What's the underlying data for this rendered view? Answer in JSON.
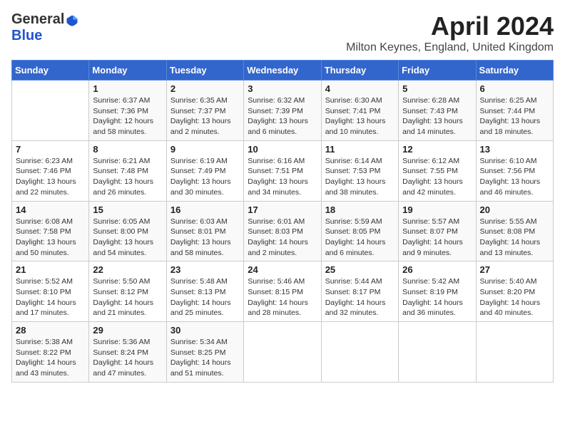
{
  "header": {
    "logo_general": "General",
    "logo_blue": "Blue",
    "month_title": "April 2024",
    "location": "Milton Keynes, England, United Kingdom"
  },
  "days_of_week": [
    "Sunday",
    "Monday",
    "Tuesday",
    "Wednesday",
    "Thursday",
    "Friday",
    "Saturday"
  ],
  "weeks": [
    [
      {
        "day": "",
        "sunrise": "",
        "sunset": "",
        "daylight": ""
      },
      {
        "day": "1",
        "sunrise": "Sunrise: 6:37 AM",
        "sunset": "Sunset: 7:36 PM",
        "daylight": "Daylight: 12 hours and 58 minutes."
      },
      {
        "day": "2",
        "sunrise": "Sunrise: 6:35 AM",
        "sunset": "Sunset: 7:37 PM",
        "daylight": "Daylight: 13 hours and 2 minutes."
      },
      {
        "day": "3",
        "sunrise": "Sunrise: 6:32 AM",
        "sunset": "Sunset: 7:39 PM",
        "daylight": "Daylight: 13 hours and 6 minutes."
      },
      {
        "day": "4",
        "sunrise": "Sunrise: 6:30 AM",
        "sunset": "Sunset: 7:41 PM",
        "daylight": "Daylight: 13 hours and 10 minutes."
      },
      {
        "day": "5",
        "sunrise": "Sunrise: 6:28 AM",
        "sunset": "Sunset: 7:43 PM",
        "daylight": "Daylight: 13 hours and 14 minutes."
      },
      {
        "day": "6",
        "sunrise": "Sunrise: 6:25 AM",
        "sunset": "Sunset: 7:44 PM",
        "daylight": "Daylight: 13 hours and 18 minutes."
      }
    ],
    [
      {
        "day": "7",
        "sunrise": "Sunrise: 6:23 AM",
        "sunset": "Sunset: 7:46 PM",
        "daylight": "Daylight: 13 hours and 22 minutes."
      },
      {
        "day": "8",
        "sunrise": "Sunrise: 6:21 AM",
        "sunset": "Sunset: 7:48 PM",
        "daylight": "Daylight: 13 hours and 26 minutes."
      },
      {
        "day": "9",
        "sunrise": "Sunrise: 6:19 AM",
        "sunset": "Sunset: 7:49 PM",
        "daylight": "Daylight: 13 hours and 30 minutes."
      },
      {
        "day": "10",
        "sunrise": "Sunrise: 6:16 AM",
        "sunset": "Sunset: 7:51 PM",
        "daylight": "Daylight: 13 hours and 34 minutes."
      },
      {
        "day": "11",
        "sunrise": "Sunrise: 6:14 AM",
        "sunset": "Sunset: 7:53 PM",
        "daylight": "Daylight: 13 hours and 38 minutes."
      },
      {
        "day": "12",
        "sunrise": "Sunrise: 6:12 AM",
        "sunset": "Sunset: 7:55 PM",
        "daylight": "Daylight: 13 hours and 42 minutes."
      },
      {
        "day": "13",
        "sunrise": "Sunrise: 6:10 AM",
        "sunset": "Sunset: 7:56 PM",
        "daylight": "Daylight: 13 hours and 46 minutes."
      }
    ],
    [
      {
        "day": "14",
        "sunrise": "Sunrise: 6:08 AM",
        "sunset": "Sunset: 7:58 PM",
        "daylight": "Daylight: 13 hours and 50 minutes."
      },
      {
        "day": "15",
        "sunrise": "Sunrise: 6:05 AM",
        "sunset": "Sunset: 8:00 PM",
        "daylight": "Daylight: 13 hours and 54 minutes."
      },
      {
        "day": "16",
        "sunrise": "Sunrise: 6:03 AM",
        "sunset": "Sunset: 8:01 PM",
        "daylight": "Daylight: 13 hours and 58 minutes."
      },
      {
        "day": "17",
        "sunrise": "Sunrise: 6:01 AM",
        "sunset": "Sunset: 8:03 PM",
        "daylight": "Daylight: 14 hours and 2 minutes."
      },
      {
        "day": "18",
        "sunrise": "Sunrise: 5:59 AM",
        "sunset": "Sunset: 8:05 PM",
        "daylight": "Daylight: 14 hours and 6 minutes."
      },
      {
        "day": "19",
        "sunrise": "Sunrise: 5:57 AM",
        "sunset": "Sunset: 8:07 PM",
        "daylight": "Daylight: 14 hours and 9 minutes."
      },
      {
        "day": "20",
        "sunrise": "Sunrise: 5:55 AM",
        "sunset": "Sunset: 8:08 PM",
        "daylight": "Daylight: 14 hours and 13 minutes."
      }
    ],
    [
      {
        "day": "21",
        "sunrise": "Sunrise: 5:52 AM",
        "sunset": "Sunset: 8:10 PM",
        "daylight": "Daylight: 14 hours and 17 minutes."
      },
      {
        "day": "22",
        "sunrise": "Sunrise: 5:50 AM",
        "sunset": "Sunset: 8:12 PM",
        "daylight": "Daylight: 14 hours and 21 minutes."
      },
      {
        "day": "23",
        "sunrise": "Sunrise: 5:48 AM",
        "sunset": "Sunset: 8:13 PM",
        "daylight": "Daylight: 14 hours and 25 minutes."
      },
      {
        "day": "24",
        "sunrise": "Sunrise: 5:46 AM",
        "sunset": "Sunset: 8:15 PM",
        "daylight": "Daylight: 14 hours and 28 minutes."
      },
      {
        "day": "25",
        "sunrise": "Sunrise: 5:44 AM",
        "sunset": "Sunset: 8:17 PM",
        "daylight": "Daylight: 14 hours and 32 minutes."
      },
      {
        "day": "26",
        "sunrise": "Sunrise: 5:42 AM",
        "sunset": "Sunset: 8:19 PM",
        "daylight": "Daylight: 14 hours and 36 minutes."
      },
      {
        "day": "27",
        "sunrise": "Sunrise: 5:40 AM",
        "sunset": "Sunset: 8:20 PM",
        "daylight": "Daylight: 14 hours and 40 minutes."
      }
    ],
    [
      {
        "day": "28",
        "sunrise": "Sunrise: 5:38 AM",
        "sunset": "Sunset: 8:22 PM",
        "daylight": "Daylight: 14 hours and 43 minutes."
      },
      {
        "day": "29",
        "sunrise": "Sunrise: 5:36 AM",
        "sunset": "Sunset: 8:24 PM",
        "daylight": "Daylight: 14 hours and 47 minutes."
      },
      {
        "day": "30",
        "sunrise": "Sunrise: 5:34 AM",
        "sunset": "Sunset: 8:25 PM",
        "daylight": "Daylight: 14 hours and 51 minutes."
      },
      {
        "day": "",
        "sunrise": "",
        "sunset": "",
        "daylight": ""
      },
      {
        "day": "",
        "sunrise": "",
        "sunset": "",
        "daylight": ""
      },
      {
        "day": "",
        "sunrise": "",
        "sunset": "",
        "daylight": ""
      },
      {
        "day": "",
        "sunrise": "",
        "sunset": "",
        "daylight": ""
      }
    ]
  ]
}
